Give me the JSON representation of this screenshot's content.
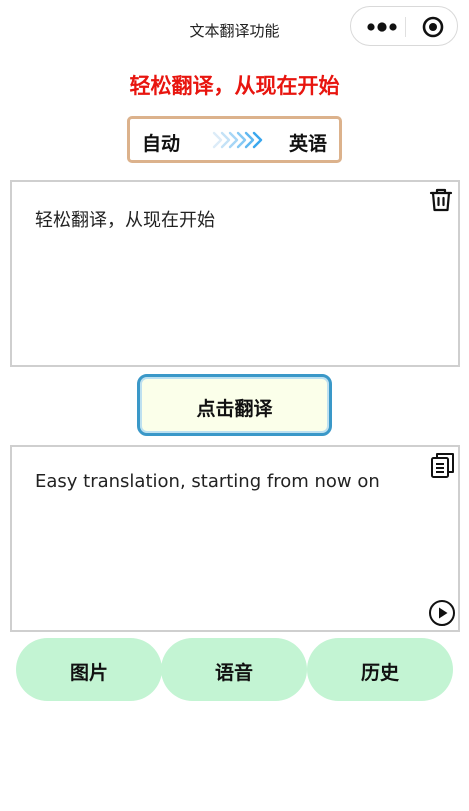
{
  "app": {
    "title": "文本翻译功能"
  },
  "capsule": {
    "more_icon": "more-dots-icon",
    "close_icon": "target-close-icon"
  },
  "headline": "轻松翻译，从现在开始",
  "language": {
    "source": "自动",
    "target": "英语",
    "arrow_icon": "chevron-arrows-icon"
  },
  "input": {
    "text": "轻松翻译，从现在开始",
    "clear_icon": "trash-icon"
  },
  "translate_button": {
    "label": "点击翻译"
  },
  "output": {
    "text": "Easy translation, starting from now on",
    "copy_icon": "copy-icon",
    "play_icon": "play-icon"
  },
  "bottom_nav": [
    {
      "label": "图片"
    },
    {
      "label": "语音"
    },
    {
      "label": "历史"
    }
  ],
  "colors": {
    "headline": "#e8150f",
    "lang_border": "#dcb28c",
    "button_border": "#3a98c8",
    "bottom_button": "#c3f4d3"
  }
}
